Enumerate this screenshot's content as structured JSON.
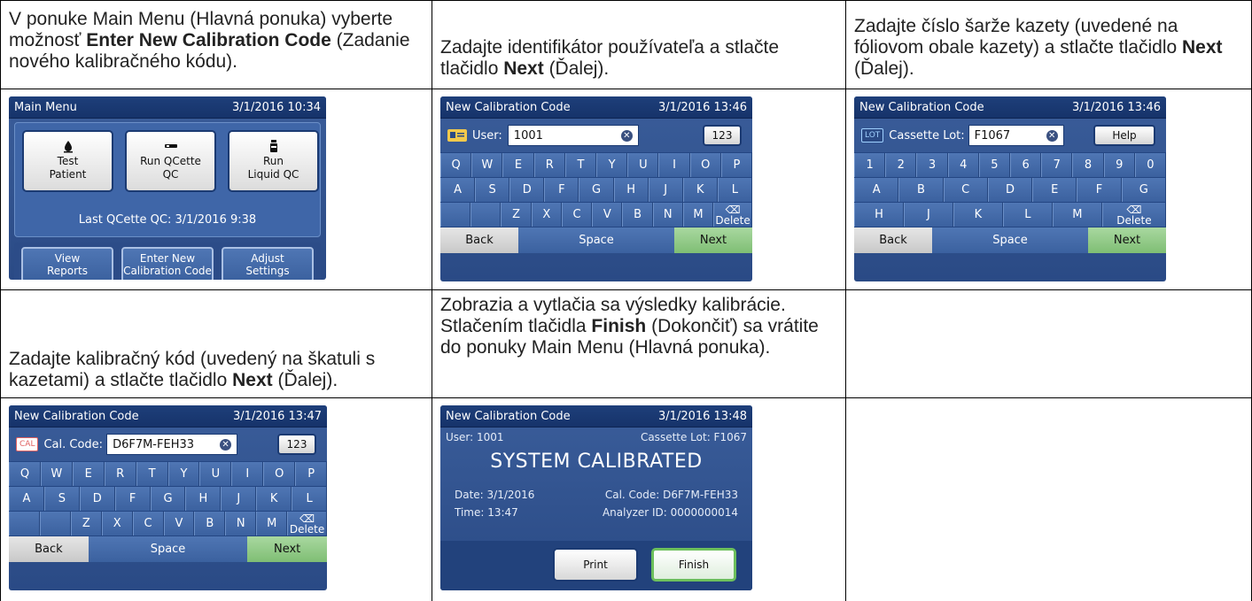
{
  "captions": {
    "c1": {
      "t1": "V ponuke Main Menu (Hlavná ponuka) vyberte možnosť ",
      "b1": "Enter New Calibration Code",
      "t2": " (Zadanie nového kalibračného kódu)."
    },
    "c2": {
      "t1": "Zadajte identifikátor používateľa a stlačte tlačidlo ",
      "b1": "Next",
      "t2": " (Ďalej)."
    },
    "c3": {
      "t1": "Zadajte číslo šarže kazety (uvedené na fóliovom obale kazety) a stlačte tlačidlo ",
      "b1": "Next",
      "t2": " (Ďalej)."
    },
    "c4": {
      "t1": "Zadajte kalibračný kód (uvedený na škatuli s kazetami) a stlačte tlačidlo ",
      "b1": "Next",
      "t2": " (Ďalej)."
    },
    "c5": {
      "t1": "Zobrazia a vytlačia sa výsledky kalibrácie. Stlačením tlačidla ",
      "b1": "Finish",
      "t2": " (Dokončiť) sa vrátite do ponuky Main Menu (Hlavná ponuka)."
    }
  },
  "main_menu": {
    "title": "Main Menu",
    "datetime": "3/1/2016 10:34",
    "btn_test": "Test Patient",
    "btn_run_qcette": "Run QCette QC",
    "btn_run_liquid": "Run Liquid QC",
    "last_qc": "Last QCette QC: 3/1/2016 9:38",
    "btn_view_reports": "View Reports",
    "btn_enter_cal": "Enter New Calibration Code",
    "btn_adjust": "Adjust Settings"
  },
  "user_screen": {
    "title": "New Calibration Code",
    "datetime": "3/1/2016 13:46",
    "label": "User:",
    "value": "1001",
    "mode_btn": "123"
  },
  "lot_screen": {
    "title": "New Calibration Code",
    "datetime": "3/1/2016 13:46",
    "badge": "LOT",
    "label": "Cassette Lot:",
    "value": "F1067",
    "help_btn": "Help"
  },
  "cal_screen": {
    "title": "New Calibration Code",
    "datetime": "3/1/2016 13:47",
    "badge": "CAL",
    "label": "Cal. Code:",
    "value": "D6F7M-FEH33",
    "mode_btn": "123"
  },
  "result_screen": {
    "title": "New Calibration Code",
    "datetime": "3/1/2016 13:48",
    "user": "User: 1001",
    "lot": "Cassette Lot: F1067",
    "status": "SYSTEM CALIBRATED",
    "date": "Date: 3/1/2016",
    "cal_code": "Cal. Code: D6F7M-FEH33",
    "time": "Time: 13:47",
    "analyzer": "Analyzer ID: 0000000014",
    "print_btn": "Print",
    "finish_btn": "Finish"
  },
  "keyboard_alpha": {
    "row1": [
      "Q",
      "W",
      "E",
      "R",
      "T",
      "Y",
      "U",
      "I",
      "O",
      "P"
    ],
    "row2": [
      "A",
      "S",
      "D",
      "F",
      "G",
      "H",
      "J",
      "K",
      "L"
    ],
    "row3": [
      "Z",
      "X",
      "C",
      "V",
      "B",
      "N",
      "M"
    ],
    "delete": "Delete",
    "back": "Back",
    "space": "Space",
    "next": "Next"
  },
  "keyboard_lot": {
    "row1": [
      "1",
      "2",
      "3",
      "4",
      "5",
      "6",
      "7",
      "8",
      "9",
      "0"
    ],
    "row2": [
      "A",
      "B",
      "C",
      "D",
      "E",
      "F",
      "G"
    ],
    "row3": [
      "H",
      "J",
      "K",
      "L",
      "M"
    ],
    "delete": "Delete",
    "back": "Back",
    "space": "Space",
    "next": "Next"
  },
  "colors": {
    "screen_blue": "#2a4a85",
    "title_bar": "#16336a",
    "next_green": "#7fbe74",
    "badge_red": "#d94a4a"
  }
}
